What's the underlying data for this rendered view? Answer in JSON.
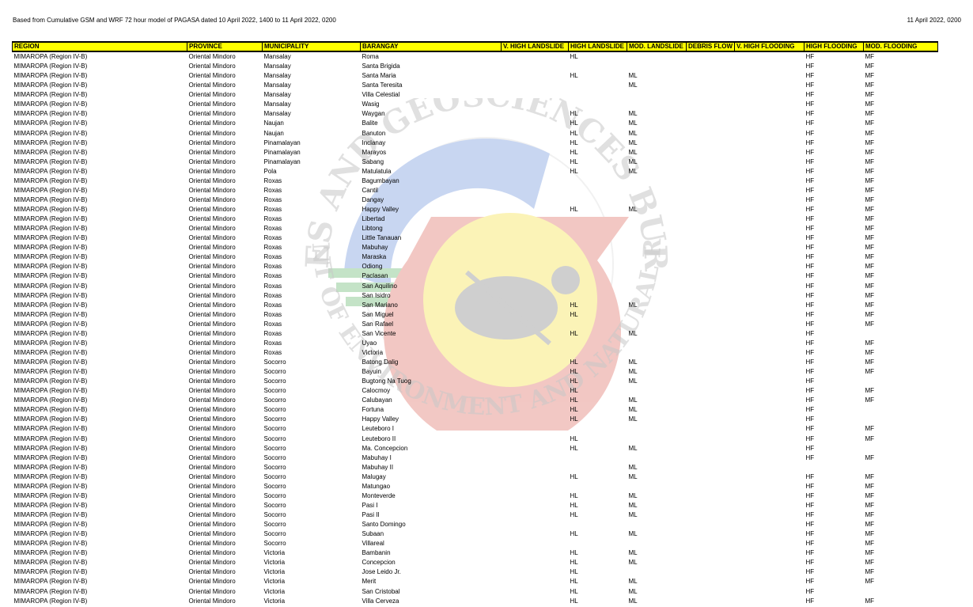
{
  "header": {
    "source_note": "Based from Cumulative GSM and WRF 72 hour model of PAGASA dated 10 April 2022, 1400 to 11 April 2022, 0200",
    "date": "11 April 2022, 0200"
  },
  "watermark": {
    "top_text": "MINES AND GEOSCIENCES BUREAU",
    "bottom_text": "DEPARTMENT OF ENVIRONMENT AND NATURAL RESOURCES",
    "colors": {
      "blue": "#3d6fd0",
      "green": "#2e9e3a",
      "red": "#d23a2a",
      "yellow": "#f2d600",
      "gray": "#555555"
    }
  },
  "table": {
    "columns": [
      "REGION",
      "PROVINCE",
      "MUNICIPALITY",
      "BARANGAY",
      "V. HIGH LANDSLIDE",
      "HIGH LANDSLIDE",
      "MOD. LANDSLIDE",
      "DEBRIS FLOW",
      "V. HIGH FLOODING",
      "HIGH FLOODING",
      "MOD. FLOODING"
    ],
    "rows": [
      [
        "MIMAROPA (Region IV-B)",
        "Oriental Mindoro",
        "Mansalay",
        "Roma",
        "",
        "HL",
        "",
        "",
        "",
        "HF",
        "MF"
      ],
      [
        "MIMAROPA (Region IV-B)",
        "Oriental Mindoro",
        "Mansalay",
        "Santa Brigida",
        "",
        "",
        "",
        "",
        "",
        "HF",
        "MF"
      ],
      [
        "MIMAROPA (Region IV-B)",
        "Oriental Mindoro",
        "Mansalay",
        "Santa Maria",
        "",
        "HL",
        "ML",
        "",
        "",
        "HF",
        "MF"
      ],
      [
        "MIMAROPA (Region IV-B)",
        "Oriental Mindoro",
        "Mansalay",
        "Santa Teresita",
        "",
        "",
        "ML",
        "",
        "",
        "HF",
        "MF"
      ],
      [
        "MIMAROPA (Region IV-B)",
        "Oriental Mindoro",
        "Mansalay",
        "Villa Celestial",
        "",
        "",
        "",
        "",
        "",
        "HF",
        "MF"
      ],
      [
        "MIMAROPA (Region IV-B)",
        "Oriental Mindoro",
        "Mansalay",
        "Wasig",
        "",
        "",
        "",
        "",
        "",
        "HF",
        "MF"
      ],
      [
        "MIMAROPA (Region IV-B)",
        "Oriental Mindoro",
        "Mansalay",
        "Waygan",
        "",
        "HL",
        "ML",
        "",
        "",
        "HF",
        "MF"
      ],
      [
        "MIMAROPA (Region IV-B)",
        "Oriental Mindoro",
        "Naujan",
        "Balite",
        "",
        "HL",
        "ML",
        "",
        "",
        "HF",
        "MF"
      ],
      [
        "MIMAROPA (Region IV-B)",
        "Oriental Mindoro",
        "Naujan",
        "Banuton",
        "",
        "HL",
        "ML",
        "",
        "",
        "HF",
        "MF"
      ],
      [
        "MIMAROPA (Region IV-B)",
        "Oriental Mindoro",
        "Pinamalayan",
        "Inclanay",
        "",
        "HL",
        "ML",
        "",
        "",
        "HF",
        "MF"
      ],
      [
        "MIMAROPA (Region IV-B)",
        "Oriental Mindoro",
        "Pinamalayan",
        "Marayos",
        "",
        "HL",
        "ML",
        "",
        "",
        "HF",
        "MF"
      ],
      [
        "MIMAROPA (Region IV-B)",
        "Oriental Mindoro",
        "Pinamalayan",
        "Sabang",
        "",
        "HL",
        "ML",
        "",
        "",
        "HF",
        "MF"
      ],
      [
        "MIMAROPA (Region IV-B)",
        "Oriental Mindoro",
        "Pola",
        "Matulatula",
        "",
        "HL",
        "ML",
        "",
        "",
        "HF",
        "MF"
      ],
      [
        "MIMAROPA (Region IV-B)",
        "Oriental Mindoro",
        "Roxas",
        "Bagumbayan",
        "",
        "",
        "",
        "",
        "",
        "HF",
        "MF"
      ],
      [
        "MIMAROPA (Region IV-B)",
        "Oriental Mindoro",
        "Roxas",
        "Cantil",
        "",
        "",
        "",
        "",
        "",
        "HF",
        "MF"
      ],
      [
        "MIMAROPA (Region IV-B)",
        "Oriental Mindoro",
        "Roxas",
        "Dangay",
        "",
        "",
        "",
        "",
        "",
        "HF",
        "MF"
      ],
      [
        "MIMAROPA (Region IV-B)",
        "Oriental Mindoro",
        "Roxas",
        "Happy Valley",
        "",
        "HL",
        "ML",
        "",
        "",
        "HF",
        "MF"
      ],
      [
        "MIMAROPA (Region IV-B)",
        "Oriental Mindoro",
        "Roxas",
        "Libertad",
        "",
        "",
        "",
        "",
        "",
        "HF",
        "MF"
      ],
      [
        "MIMAROPA (Region IV-B)",
        "Oriental Mindoro",
        "Roxas",
        "Libtong",
        "",
        "",
        "",
        "",
        "",
        "HF",
        "MF"
      ],
      [
        "MIMAROPA (Region IV-B)",
        "Oriental Mindoro",
        "Roxas",
        "Little Tanauan",
        "",
        "",
        "",
        "",
        "",
        "HF",
        "MF"
      ],
      [
        "MIMAROPA (Region IV-B)",
        "Oriental Mindoro",
        "Roxas",
        "Mabuhay",
        "",
        "",
        "",
        "",
        "",
        "HF",
        "MF"
      ],
      [
        "MIMAROPA (Region IV-B)",
        "Oriental Mindoro",
        "Roxas",
        "Maraska",
        "",
        "",
        "",
        "",
        "",
        "HF",
        "MF"
      ],
      [
        "MIMAROPA (Region IV-B)",
        "Oriental Mindoro",
        "Roxas",
        "Odiong",
        "",
        "",
        "",
        "",
        "",
        "HF",
        "MF"
      ],
      [
        "MIMAROPA (Region IV-B)",
        "Oriental Mindoro",
        "Roxas",
        "Paclasan",
        "",
        "",
        "",
        "",
        "",
        "HF",
        "MF"
      ],
      [
        "MIMAROPA (Region IV-B)",
        "Oriental Mindoro",
        "Roxas",
        "San Aquilino",
        "",
        "",
        "",
        "",
        "",
        "HF",
        "MF"
      ],
      [
        "MIMAROPA (Region IV-B)",
        "Oriental Mindoro",
        "Roxas",
        "San Isidro",
        "",
        "",
        "",
        "",
        "",
        "HF",
        "MF"
      ],
      [
        "MIMAROPA (Region IV-B)",
        "Oriental Mindoro",
        "Roxas",
        "San Mariano",
        "",
        "HL",
        "ML",
        "",
        "",
        "HF",
        "MF"
      ],
      [
        "MIMAROPA (Region IV-B)",
        "Oriental Mindoro",
        "Roxas",
        "San Miguel",
        "",
        "HL",
        "",
        "",
        "",
        "HF",
        "MF"
      ],
      [
        "MIMAROPA (Region IV-B)",
        "Oriental Mindoro",
        "Roxas",
        "San Rafael",
        "",
        "",
        "",
        "",
        "",
        "HF",
        "MF"
      ],
      [
        "MIMAROPA (Region IV-B)",
        "Oriental Mindoro",
        "Roxas",
        "San Vicente",
        "",
        "HL",
        "ML",
        "",
        "",
        "HF",
        ""
      ],
      [
        "MIMAROPA (Region IV-B)",
        "Oriental Mindoro",
        "Roxas",
        "Uyao",
        "",
        "",
        "",
        "",
        "",
        "HF",
        "MF"
      ],
      [
        "MIMAROPA (Region IV-B)",
        "Oriental Mindoro",
        "Roxas",
        "Victoria",
        "",
        "",
        "",
        "",
        "",
        "HF",
        "MF"
      ],
      [
        "MIMAROPA (Region IV-B)",
        "Oriental Mindoro",
        "Socorro",
        "Batong Dalig",
        "",
        "HL",
        "ML",
        "",
        "",
        "HF",
        "MF"
      ],
      [
        "MIMAROPA (Region IV-B)",
        "Oriental Mindoro",
        "Socorro",
        "Bayuin",
        "",
        "HL",
        "ML",
        "",
        "",
        "HF",
        "MF"
      ],
      [
        "MIMAROPA (Region IV-B)",
        "Oriental Mindoro",
        "Socorro",
        "Bugtong Na Tuog",
        "",
        "HL",
        "ML",
        "",
        "",
        "HF",
        ""
      ],
      [
        "MIMAROPA (Region IV-B)",
        "Oriental Mindoro",
        "Socorro",
        "Calocmoy",
        "",
        "HL",
        "",
        "",
        "",
        "HF",
        "MF"
      ],
      [
        "MIMAROPA (Region IV-B)",
        "Oriental Mindoro",
        "Socorro",
        "Calubayan",
        "",
        "HL",
        "ML",
        "",
        "",
        "HF",
        "MF"
      ],
      [
        "MIMAROPA (Region IV-B)",
        "Oriental Mindoro",
        "Socorro",
        "Fortuna",
        "",
        "HL",
        "ML",
        "",
        "",
        "HF",
        ""
      ],
      [
        "MIMAROPA (Region IV-B)",
        "Oriental Mindoro",
        "Socorro",
        "Happy Valley",
        "",
        "HL",
        "ML",
        "",
        "",
        "HF",
        ""
      ],
      [
        "MIMAROPA (Region IV-B)",
        "Oriental Mindoro",
        "Socorro",
        "Leuteboro I",
        "",
        "",
        "",
        "",
        "",
        "HF",
        "MF"
      ],
      [
        "MIMAROPA (Region IV-B)",
        "Oriental Mindoro",
        "Socorro",
        "Leuteboro II",
        "",
        "HL",
        "",
        "",
        "",
        "HF",
        "MF"
      ],
      [
        "MIMAROPA (Region IV-B)",
        "Oriental Mindoro",
        "Socorro",
        "Ma. Concepcion",
        "",
        "HL",
        "ML",
        "",
        "",
        "HF",
        ""
      ],
      [
        "MIMAROPA (Region IV-B)",
        "Oriental Mindoro",
        "Socorro",
        "Mabuhay I",
        "",
        "",
        "",
        "",
        "",
        "HF",
        "MF"
      ],
      [
        "MIMAROPA (Region IV-B)",
        "Oriental Mindoro",
        "Socorro",
        "Mabuhay II",
        "",
        "",
        "ML",
        "",
        "",
        "",
        ""
      ],
      [
        "MIMAROPA (Region IV-B)",
        "Oriental Mindoro",
        "Socorro",
        "Malugay",
        "",
        "HL",
        "ML",
        "",
        "",
        "HF",
        "MF"
      ],
      [
        "MIMAROPA (Region IV-B)",
        "Oriental Mindoro",
        "Socorro",
        "Matungao",
        "",
        "",
        "",
        "",
        "",
        "HF",
        "MF"
      ],
      [
        "MIMAROPA (Region IV-B)",
        "Oriental Mindoro",
        "Socorro",
        "Monteverde",
        "",
        "HL",
        "ML",
        "",
        "",
        "HF",
        "MF"
      ],
      [
        "MIMAROPA (Region IV-B)",
        "Oriental Mindoro",
        "Socorro",
        "Pasi I",
        "",
        "HL",
        "ML",
        "",
        "",
        "HF",
        "MF"
      ],
      [
        "MIMAROPA (Region IV-B)",
        "Oriental Mindoro",
        "Socorro",
        "Pasi II",
        "",
        "HL",
        "ML",
        "",
        "",
        "HF",
        "MF"
      ],
      [
        "MIMAROPA (Region IV-B)",
        "Oriental Mindoro",
        "Socorro",
        "Santo Domingo",
        "",
        "",
        "",
        "",
        "",
        "HF",
        "MF"
      ],
      [
        "MIMAROPA (Region IV-B)",
        "Oriental Mindoro",
        "Socorro",
        "Subaan",
        "",
        "HL",
        "ML",
        "",
        "",
        "HF",
        "MF"
      ],
      [
        "MIMAROPA (Region IV-B)",
        "Oriental Mindoro",
        "Socorro",
        "Villareal",
        "",
        "",
        "",
        "",
        "",
        "HF",
        "MF"
      ],
      [
        "MIMAROPA (Region IV-B)",
        "Oriental Mindoro",
        "Victoria",
        "Bambanin",
        "",
        "HL",
        "ML",
        "",
        "",
        "HF",
        "MF"
      ],
      [
        "MIMAROPA (Region IV-B)",
        "Oriental Mindoro",
        "Victoria",
        "Concepcion",
        "",
        "HL",
        "ML",
        "",
        "",
        "HF",
        "MF"
      ],
      [
        "MIMAROPA (Region IV-B)",
        "Oriental Mindoro",
        "Victoria",
        "Jose Leido Jr.",
        "",
        "HL",
        "",
        "",
        "",
        "HF",
        "MF"
      ],
      [
        "MIMAROPA (Region IV-B)",
        "Oriental Mindoro",
        "Victoria",
        "Merit",
        "",
        "HL",
        "ML",
        "",
        "",
        "HF",
        "MF"
      ],
      [
        "MIMAROPA (Region IV-B)",
        "Oriental Mindoro",
        "Victoria",
        "San Cristobal",
        "",
        "HL",
        "ML",
        "",
        "",
        "HF",
        ""
      ],
      [
        "MIMAROPA (Region IV-B)",
        "Oriental Mindoro",
        "Victoria",
        "Villa Cerveza",
        "",
        "HL",
        "ML",
        "",
        "",
        "HF",
        "MF"
      ]
    ]
  }
}
